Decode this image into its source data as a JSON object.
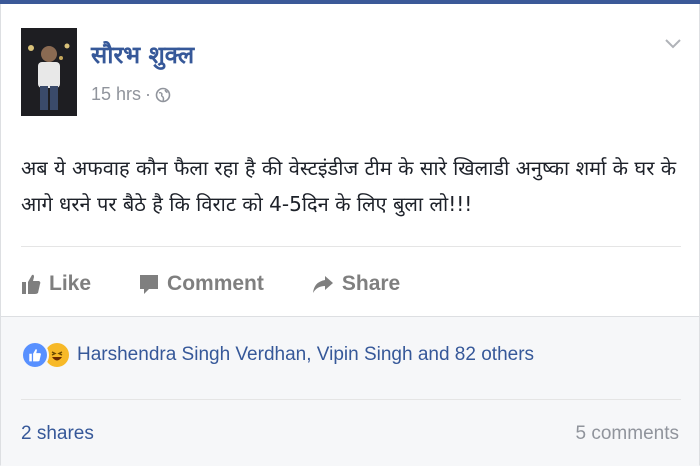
{
  "post": {
    "author": "सौरभ शुक्ल",
    "timestamp": "15 hrs",
    "separator": "·",
    "privacy_icon": "globe-icon",
    "text": "अब ये अफवाह कौन फैला रहा है की वेस्टइंडीज टीम के सारे खिलाडी अनुष्का शर्मा के घर के आगे धरने पर बैठे है कि विराट को 4-5दिन के लिए बुला लो!!!"
  },
  "actions": {
    "like_label": "Like",
    "comment_label": "Comment",
    "share_label": "Share"
  },
  "reactions": {
    "icons": [
      "like-reaction-icon",
      "haha-reaction-icon"
    ],
    "names": "Harshendra Singh Verdhan, Vipin Singh and 82 others"
  },
  "stats": {
    "shares": "2 shares",
    "comments": "5 comments"
  },
  "colors": {
    "link": "#365899",
    "muted": "#90949c",
    "like_blue": "#5890ff",
    "haha_yellow": "#f7b928",
    "brand": "#3b5998"
  }
}
